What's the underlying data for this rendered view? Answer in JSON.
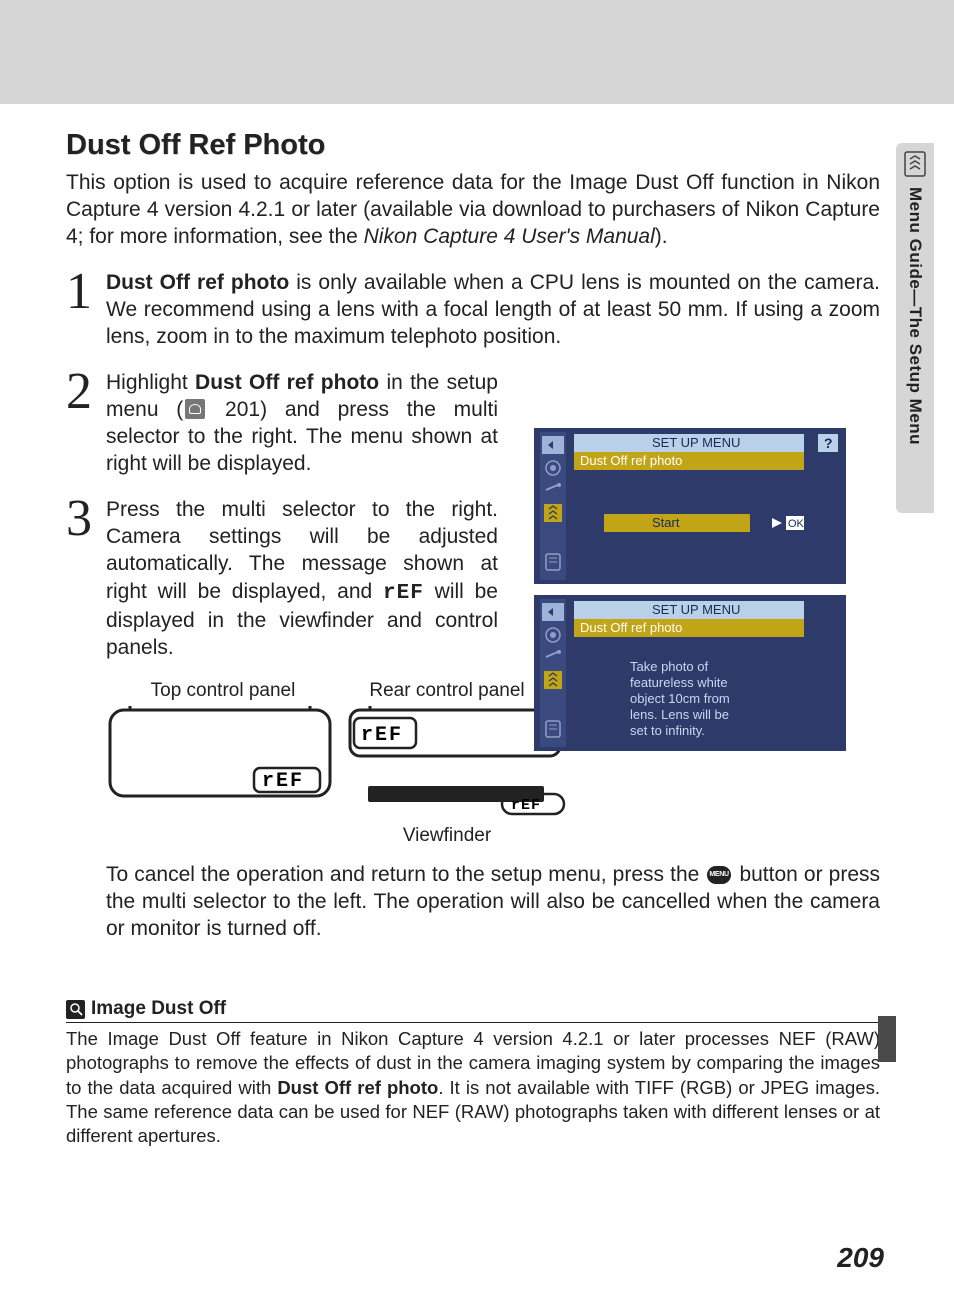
{
  "sidebar": {
    "label": "Menu Guide—The Setup Menu"
  },
  "title": "Dust Off Ref Photo",
  "intro": {
    "part1": "This option is used to acquire reference data for the Image Dust Off function in Nikon Capture 4 version 4.2.1 or later (available via download to purchasers of Nikon Capture 4; for more information, see the ",
    "italic": "Nikon Capture 4 User's Manual",
    "part2": ")."
  },
  "steps": {
    "s1": {
      "no": "1",
      "b": "Dust Off ref photo",
      "tail": " is only available when a CPU lens is mounted on the camera.  We recommend using a lens with a focal length of at least 50 mm.  If using a zoom lens, zoom in to the maximum telephoto position."
    },
    "s2": {
      "no": "2",
      "pre": "Highlight ",
      "b": "Dust Off ref photo",
      "mid": " in the setup menu (",
      "page_ref": " 201",
      "tail": ") and press the multi selector to the right.  The menu shown at right will be displayed."
    },
    "s3": {
      "no": "3",
      "line1": "Press the multi selector to the right.  Camera settings will be adjusted automatically.  The message shown at right will be displayed, and ",
      "seg": "rEF",
      "line2": " will be displayed in the viewfinder and control panels."
    }
  },
  "screen1": {
    "title": "SET UP MENU",
    "subtitle": "Dust Off ref photo",
    "button": "Start",
    "ok": "OK"
  },
  "screen2": {
    "title": "SET UP MENU",
    "subtitle": "Dust Off ref photo",
    "msg_l1": "Take photo of",
    "msg_l2": "featureless white",
    "msg_l3": "object 10cm from",
    "msg_l4": "lens. Lens will be",
    "msg_l5": "set to infinity."
  },
  "panels": {
    "top": "Top control panel",
    "rear": "Rear control panel",
    "vf": "Viewfinder",
    "seg": "rEF"
  },
  "cancel": {
    "part1": "To cancel the operation and return to the setup menu, press the ",
    "part2": " button or press the multi selector to the left.  The operation will also be cancelled when the camera or monitor is turned off."
  },
  "note": {
    "title": "Image Dust Off",
    "body_a": "The Image Dust Off feature in Nikon Capture 4 version 4.2.1 or later processes NEF (RAW) photographs to remove the effects of dust in the camera imaging system by comparing the images to the data acquired with ",
    "body_b": "Dust Off ref photo",
    "body_c": ".  It is not available with TIFF (RGB) or JPEG images.  The same reference data can be used for NEF (RAW) photographs taken with different lenses or at different apertures."
  },
  "page_number": "209"
}
